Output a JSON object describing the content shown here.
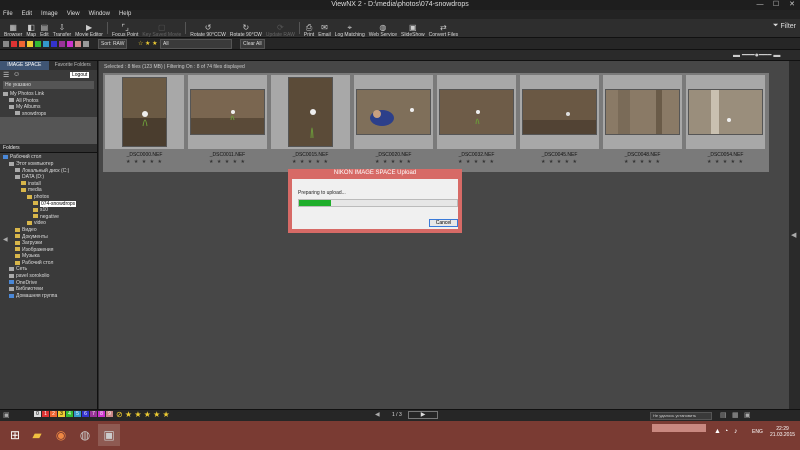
{
  "window": {
    "title": "ViewNX 2 - D:\\media\\photos\\074-snowdrops"
  },
  "menu": [
    "File",
    "Edit",
    "Image",
    "View",
    "Window",
    "Help"
  ],
  "toolbar": [
    {
      "label": "Browser",
      "icon": "browser-icon",
      "enabled": true
    },
    {
      "label": "Map",
      "icon": "map-icon",
      "enabled": true
    },
    {
      "label": "Edit",
      "icon": "edit-icon",
      "enabled": true
    },
    {
      "label": "Transfer",
      "icon": "transfer-icon",
      "enabled": true
    },
    {
      "label": "Movie Editor",
      "icon": "movie-icon",
      "enabled": true
    },
    {
      "label": "Focus Point",
      "icon": "focus-icon",
      "enabled": true
    },
    {
      "label": "Key Saved Movie",
      "icon": "keymovie-icon",
      "enabled": false
    },
    {
      "label": "Rotate 90°CCW",
      "icon": "rotate-ccw-icon",
      "enabled": true
    },
    {
      "label": "Rotate 90°CW",
      "icon": "rotate-cw-icon",
      "enabled": true
    },
    {
      "label": "Update RAW",
      "icon": "update-raw-icon",
      "enabled": false
    },
    {
      "label": "Print",
      "icon": "print-icon",
      "enabled": true
    },
    {
      "label": "Email",
      "icon": "email-icon",
      "enabled": true
    },
    {
      "label": "Log Matching",
      "icon": "log-icon",
      "enabled": true
    },
    {
      "label": "Web Service",
      "icon": "web-icon",
      "enabled": true
    },
    {
      "label": "SlideShow",
      "icon": "slideshow-icon",
      "enabled": true
    },
    {
      "label": "Convert Files",
      "icon": "convert-icon",
      "enabled": true
    }
  ],
  "filter_label": "Filter",
  "sort": {
    "label": "Sort: RAW"
  },
  "clear_all": "Clear All",
  "all_option": "All",
  "left": {
    "tabs": [
      "IMAGE SPACE",
      "Favorite Folders"
    ],
    "logout": "Logout",
    "account": "Не указано",
    "photos": {
      "header": "My Photos Link",
      "items": [
        "All Photos",
        "My Albums",
        "snowdrops"
      ]
    },
    "folders_header": "Folders",
    "tree": [
      {
        "label": "Рабочий стол",
        "level": 0,
        "icon": "blue"
      },
      {
        "label": "Этот компьютер",
        "level": 1,
        "icon": "gray"
      },
      {
        "label": "Локальный диск (C:)",
        "level": 2,
        "icon": "gray"
      },
      {
        "label": "DATA (D:)",
        "level": 2,
        "icon": "gray"
      },
      {
        "label": "install",
        "level": 3,
        "icon": "yellow"
      },
      {
        "label": "media",
        "level": 3,
        "icon": "yellow"
      },
      {
        "label": "photos",
        "level": 4,
        "icon": "yellow"
      },
      {
        "label": "074-snowdrops",
        "level": 5,
        "icon": "yellow",
        "selected": true
      },
      {
        "label": "s10",
        "level": 5,
        "icon": "yellow"
      },
      {
        "label": "negative",
        "level": 5,
        "icon": "yellow"
      },
      {
        "label": "video",
        "level": 4,
        "icon": "yellow"
      },
      {
        "label": "Видео",
        "level": 1,
        "icon": "yellow"
      },
      {
        "label": "Документы",
        "level": 1,
        "icon": "yellow"
      },
      {
        "label": "Загрузки",
        "level": 1,
        "icon": "yellow"
      },
      {
        "label": "Изображения",
        "level": 1,
        "icon": "yellow"
      },
      {
        "label": "Музыка",
        "level": 1,
        "icon": "yellow"
      },
      {
        "label": "Рабочий стол",
        "level": 1,
        "icon": "yellow"
      },
      {
        "label": "Сеть",
        "level": 0,
        "icon": "gray"
      },
      {
        "label": "pavel sorokolio",
        "level": 0,
        "icon": "gray"
      },
      {
        "label": "OneDrive",
        "level": 0,
        "icon": "blue"
      },
      {
        "label": "Библиотеки",
        "level": 0,
        "icon": "gray"
      },
      {
        "label": "Домашняя группа",
        "level": 0,
        "icon": "blue"
      }
    ]
  },
  "status": "Selected : 8 files (123 MB) | Filtering On : 8 of 74 files displayed",
  "thumbs": [
    {
      "file": "_DSC0000.NEF",
      "stars": "★ ★ ★ ★ ★",
      "portrait": true
    },
    {
      "file": "_DSC0011.NEF",
      "stars": "★ ★ ★ ★ ★",
      "portrait": false
    },
    {
      "file": "_DSC0015.NEF",
      "stars": "★ ★ ★ ★ ★",
      "portrait": true
    },
    {
      "file": "_DSC0020.NEF",
      "stars": "★ ★ ★ ★ ★",
      "portrait": false
    },
    {
      "file": "_DSC0032.NEF",
      "stars": "★ ★ ★ ★ ★",
      "portrait": false
    },
    {
      "file": "_DSC0045.NEF",
      "stars": "★ ★ ★ ★ ★",
      "portrait": false
    },
    {
      "file": "_DSC0048.NEF",
      "stars": "★ ★ ★ ★ ★",
      "portrait": false
    },
    {
      "file": "_DSC0054.NEF",
      "stars": "★ ★ ★ ★ ★",
      "portrait": false
    }
  ],
  "dialog": {
    "title": "NIKON IMAGE SPACE Upload",
    "message": "Preparing to upload...",
    "progress": 0.2,
    "cancel": "Cancel"
  },
  "bottom": {
    "page": "1 / 3",
    "dropdown": "Не удалось установить",
    "numbers": [
      "1",
      "2",
      "3",
      "4",
      "5",
      "6",
      "7",
      "8",
      "9"
    ]
  },
  "taskbar": {
    "time": "22:29",
    "date": "21.03.2015",
    "lang": "ENG"
  },
  "colors": {
    "accent": "#3f5574",
    "dialog_border": "#d76a66",
    "progress": "#1fae2b",
    "taskbar": "#7a3b33"
  }
}
